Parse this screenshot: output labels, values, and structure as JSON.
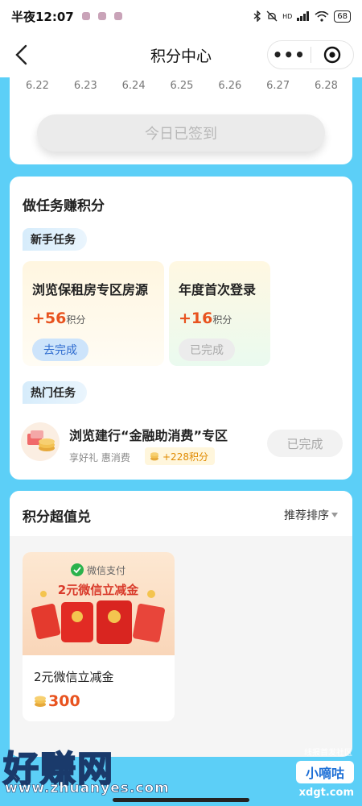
{
  "status_bar": {
    "time": "半夜12:07",
    "battery": "68",
    "network": "HD"
  },
  "nav": {
    "title": "积分中心",
    "more_icon": "more-dots-icon",
    "target_icon": "target-icon",
    "back_icon": "back-arrow-icon"
  },
  "checkin": {
    "dates": [
      "6.22",
      "6.23",
      "6.24",
      "6.25",
      "6.26",
      "6.27",
      "6.28"
    ],
    "button_label": "今日已签到"
  },
  "tasks": {
    "title": "做任务赚积分",
    "newbie_tag": "新手任务",
    "newbie": [
      {
        "name": "浏览保租房专区房源",
        "points": "+56",
        "unit": "积分",
        "button": "去完成",
        "done": false
      },
      {
        "name": "年度首次登录",
        "points": "+16",
        "unit": "积分",
        "button": "已完成",
        "done": true
      }
    ],
    "hot_tag": "热门任务",
    "hot": [
      {
        "name": "浏览建行“金融助消费”专区",
        "subtitle": "享好礼 惠消费",
        "points": "+228积分",
        "button": "已完成"
      }
    ]
  },
  "exchange": {
    "title": "积分超值兑",
    "sort_label": "推荐排序",
    "products": [
      {
        "image_brand": "微信支付",
        "image_title": "2元微信立减金",
        "name": "2元微信立减金",
        "price": "300"
      }
    ]
  },
  "watermark": {
    "left_text": "好赚网",
    "left_url": "www.zhuanyes.com",
    "right_top": "线报首发社区",
    "right_badge": "小嘀咕",
    "right_url": "xdgt.com"
  },
  "colors": {
    "accent": "#e8531f",
    "bg": "#5ccff7",
    "tag_bg": "#d6ecfb"
  }
}
